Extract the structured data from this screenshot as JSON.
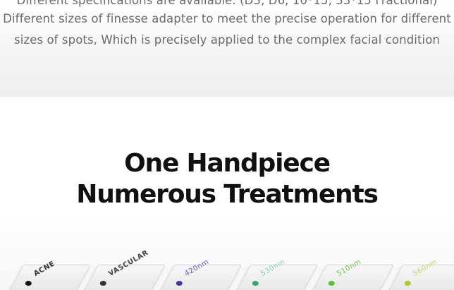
{
  "specs": {
    "line1": "Different specifications are available. (D3, D6, 10*15, 33*15 Fractional)",
    "line2": "Different sizes of finesse adapter to meet the precise operation for different",
    "line3": "sizes of spots, Which is precisely applied to the complex facial condition"
  },
  "hero": {
    "headline_line1": "One Handpiece",
    "headline_line2": "Numerous Treatments"
  },
  "filters": [
    {
      "label": "ACNE",
      "dot_color": "#111111"
    },
    {
      "label": "VASCULAR",
      "dot_color": "#333333"
    },
    {
      "label": "420nm",
      "dot_color": "#3a3f9a"
    },
    {
      "label": "530nm",
      "dot_color": "#3aa66a"
    },
    {
      "label": "510nm",
      "dot_color": "#5fbf3a"
    },
    {
      "label": "560nm",
      "dot_color": "#a6cf2a"
    }
  ],
  "colors": {
    "headline": "#111111",
    "body_text": "#6a6a6a"
  }
}
